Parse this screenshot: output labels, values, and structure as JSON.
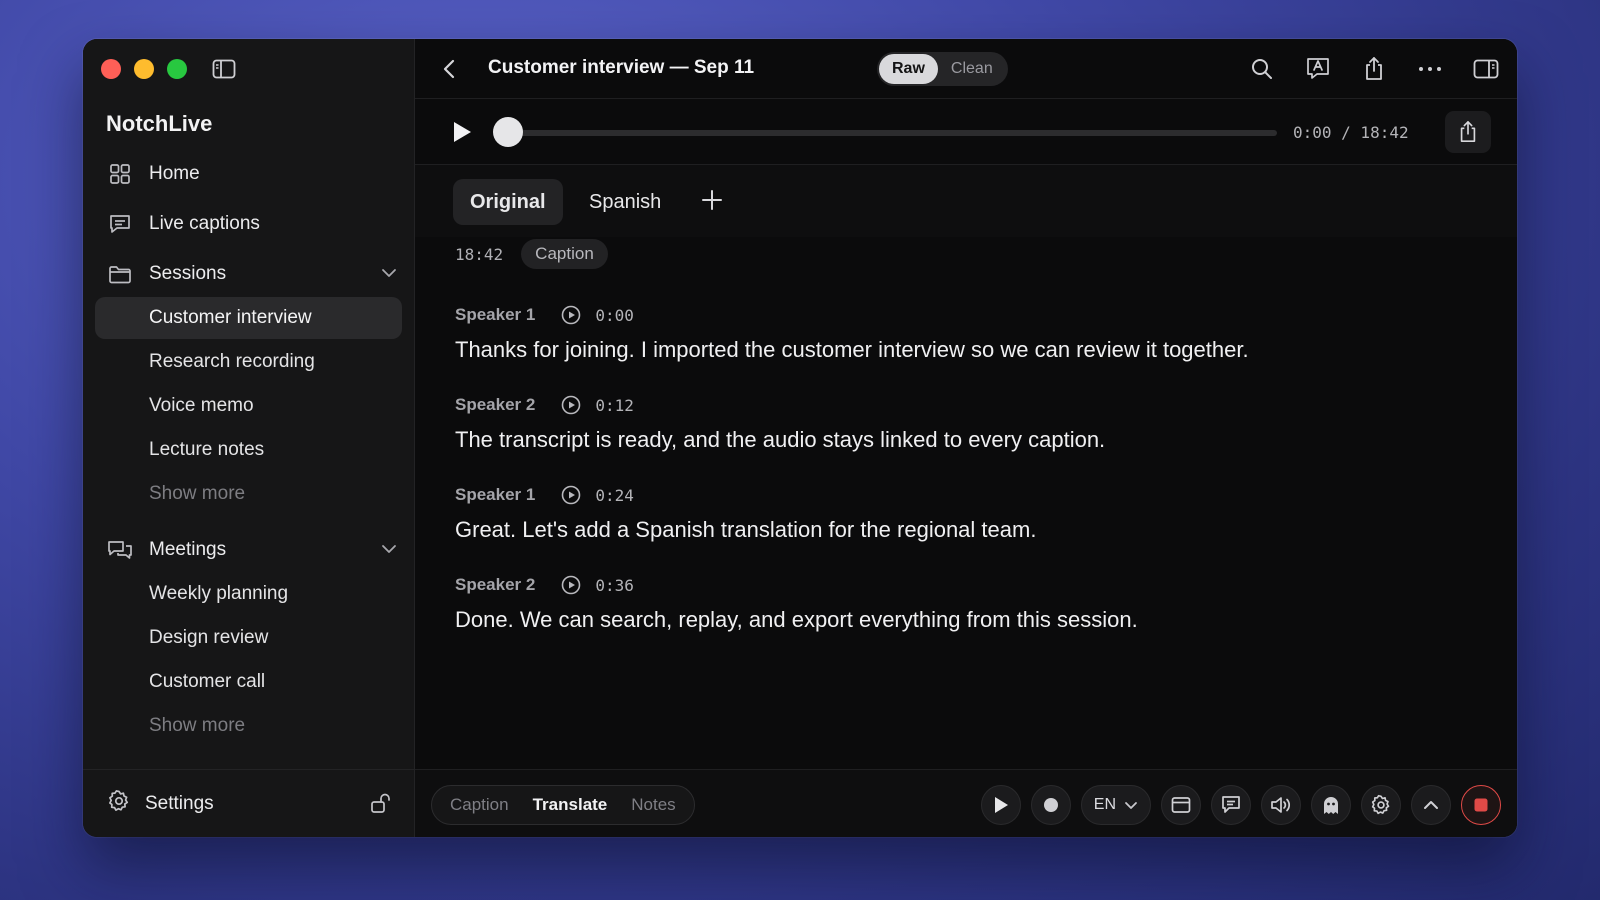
{
  "app": {
    "name": "NotchLive"
  },
  "sidebar": {
    "nav": [
      {
        "label": "Home",
        "icon": "grid-icon"
      },
      {
        "label": "Live captions",
        "icon": "caption-bubble-icon"
      }
    ],
    "sessions": {
      "label": "Sessions",
      "icon": "folder-icon",
      "items": [
        "Customer interview",
        "Research recording",
        "Voice memo",
        "Lecture notes"
      ],
      "active": "Customer interview",
      "show_more": "Show more"
    },
    "meetings": {
      "label": "Meetings",
      "icon": "chat-bubbles-icon",
      "items": [
        "Weekly planning",
        "Design review",
        "Customer call"
      ],
      "show_more": "Show more"
    },
    "footer": {
      "settings_label": "Settings",
      "icon": "gear-icon"
    }
  },
  "header": {
    "title": "Customer interview — Sep 11",
    "view_toggle": {
      "options": [
        "Raw",
        "Clean"
      ],
      "selected": "Raw"
    }
  },
  "player": {
    "timecode": "0:00 / 18:42",
    "progress": 0
  },
  "language_tabs": {
    "tabs": [
      "Original",
      "Spanish"
    ],
    "selected": "Original"
  },
  "transcript": {
    "duration": "18:42",
    "badge": "Caption",
    "entries": [
      {
        "speaker": "Speaker 1",
        "time": "0:00",
        "text": "Thanks for joining. I imported the customer interview so we can review it together."
      },
      {
        "speaker": "Speaker 2",
        "time": "0:12",
        "text": "The transcript is ready, and the audio stays linked to every caption."
      },
      {
        "speaker": "Speaker 1",
        "time": "0:24",
        "text": "Great. Let's add a Spanish translation for the regional team."
      },
      {
        "speaker": "Speaker 2",
        "time": "0:36",
        "text": "Done. We can search, replay, and export everything from this session."
      }
    ]
  },
  "bottom_bar": {
    "modes": [
      "Caption",
      "Translate",
      "Notes"
    ],
    "selected_mode": "Translate",
    "language": "EN"
  },
  "colors": {
    "record_red": "#e04a47",
    "accent_active": "#d9d9dc"
  }
}
